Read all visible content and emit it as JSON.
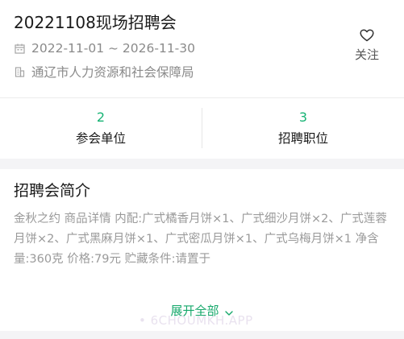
{
  "header": {
    "title": "20221108现场招聘会",
    "date_range": "2022-11-01 ~ 2026-11-30",
    "organizer": "通辽市人力资源和社会保障局",
    "date_icon": "calendar-icon",
    "org_icon": "building-icon",
    "follow": {
      "icon": "heart-icon",
      "label": "关注"
    }
  },
  "stats": [
    {
      "value": "2",
      "label": "参会单位"
    },
    {
      "value": "3",
      "label": "招聘职位"
    }
  ],
  "intro": {
    "title": "招聘会简介",
    "body": "金秋之约 商品详情 内配:广式橘香月饼×1、广式细沙月饼×2、广式莲蓉月饼×2、广式黑麻月饼×1、广式密瓜月饼×1、广式乌梅月饼×1 净含量:360克 价格:79元 贮藏条件:请置于",
    "expand_label": "展开全部",
    "expand_icon": "chevron-down-icon"
  },
  "watermark": "• 6CHOUMKH.APP",
  "colors": {
    "accent": "#16b374",
    "background": "#f4f4f6",
    "muted_text": "#9a9a9a"
  }
}
